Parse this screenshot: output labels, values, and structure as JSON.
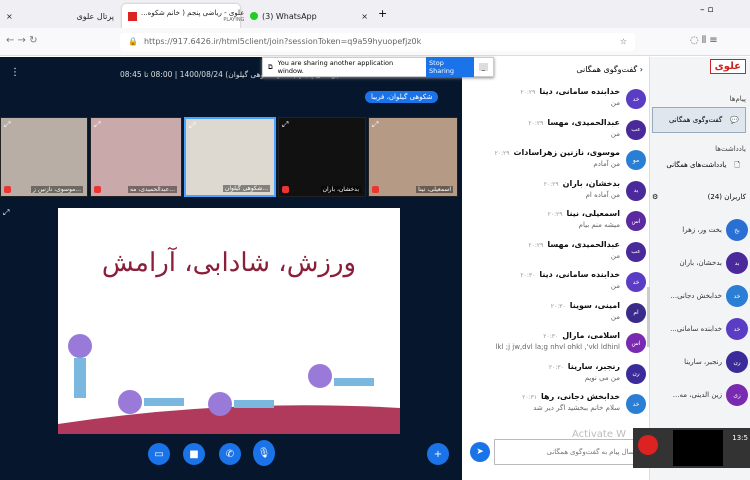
{
  "browser": {
    "tabs": [
      {
        "label": "پرتال علوی"
      },
      {
        "label": "علوی - ریاضی پنجم ( خانم شکوه...",
        "sub": "PLAYING"
      },
      {
        "label": "(3) WhatsApp"
      }
    ],
    "url": "https://917.6426.ir/html5client/join?sessionToken=q9a59hyuopefjz0k"
  },
  "share_banner": {
    "text": "You are sharing another application window.",
    "stop": "Stop Sharing"
  },
  "meeting": {
    "title": "(ریاضی پنجم ( خانم شکوهی گیلوان) 1400/08/24 | 08:00 تا 08:45",
    "presenter": "شکوهی گیلوان، فریبا",
    "tiles": [
      {
        "name": "موسوی، نازنین ز..."
      },
      {
        "name": "عبدالحمیدی، مه..."
      },
      {
        "name": "شکوهی گیلوان..."
      },
      {
        "name": "بدخشان، باران"
      },
      {
        "name": "اسمعیلی، نینا"
      }
    ],
    "slide_title": "ورزش، شادابی، آرامش"
  },
  "chat": {
    "title": "گفت‌وگوی همگانی",
    "placeholder": "ارسال پیام به گفت‌وگوی همگانی",
    "watermark": "Activate W",
    "messages": [
      {
        "av": "خد",
        "name": "خدابنده سامانی، دینا",
        "time": "۲۰:۲۹",
        "text": "من",
        "color": "#5b3cc4"
      },
      {
        "av": "عب",
        "name": "عبدالحمیدی، مهسا",
        "time": "۲۰:۲۹",
        "text": "من",
        "color": "#4a2a9a"
      },
      {
        "av": "مو",
        "name": "موسوی، نازنین زهراسادات",
        "time": "۲۰:۲۹",
        "text": "من آمادم",
        "color": "#2a7fd4"
      },
      {
        "av": "بد",
        "name": "بدخشان، باران",
        "time": "۲۰:۲۹",
        "text": "من آماده ام",
        "color": "#4a2a9a"
      },
      {
        "av": "اس",
        "name": "اسمعیلی، نینا",
        "time": "۲۰:۲۹",
        "text": "میشه منم بیام",
        "color": "#5b2aa0"
      },
      {
        "av": "عب",
        "name": "عبدالحمیدی، مهسا",
        "time": "۲۰:۲۹",
        "text": "من",
        "color": "#4a2a9a"
      },
      {
        "av": "خد",
        "name": "خدابنده سامانی، دینا",
        "time": "۲۰:۳۰",
        "text": "من",
        "color": "#5b3cc4"
      },
      {
        "av": "ام",
        "name": "امینی، سوینا",
        "time": "۲۰:۳۰",
        "text": "من",
        "color": "#3a2a8a"
      },
      {
        "av": "اس",
        "name": "اسلامی، مارال",
        "time": "۲۰:۳۰",
        "text": "lkl ;j jw,dvl la;g nhvl ohkl ,'vkl ldhinl",
        "color": "#7a2ab0"
      },
      {
        "av": "رن",
        "name": "رنجبر، سارینا",
        "time": "۲۰:۳۰",
        "text": "من می نویم",
        "color": "#3a2a9a"
      },
      {
        "av": "خد",
        "name": "خدابخش دجانی، رها",
        "time": "۲۰:۳۱",
        "text": "سلام خانم ببخشید اگر دیر شد",
        "color": "#2a7fd4"
      }
    ]
  },
  "sidebar": {
    "logo": "علوی",
    "messages_heading": "پیام‌ها",
    "public_chat": "گفت‌وگوی همگانی",
    "notes_heading": "یادداشت‌ها",
    "shared_notes": "یادداشت‌های همگانی",
    "users_heading": "کاربران (24)",
    "users": [
      {
        "av": "بخ",
        "name": "بخت ور، زهرا",
        "color": "#2a6fd4"
      },
      {
        "av": "بد",
        "name": "بدخشان، باران",
        "color": "#4a2a9a"
      },
      {
        "av": "خد",
        "name": "خدابخش دجانی...",
        "color": "#2a7fd4"
      },
      {
        "av": "خد",
        "name": "خدابنده سامانی...",
        "color": "#5b3cc4"
      },
      {
        "av": "رن",
        "name": "رنجبر، سارینا",
        "color": "#3a2a9a"
      },
      {
        "av": "زی",
        "name": "زین الدینی، مه...",
        "color": "#7a2ab0"
      }
    ]
  },
  "recorder": {
    "time": "13:5"
  }
}
